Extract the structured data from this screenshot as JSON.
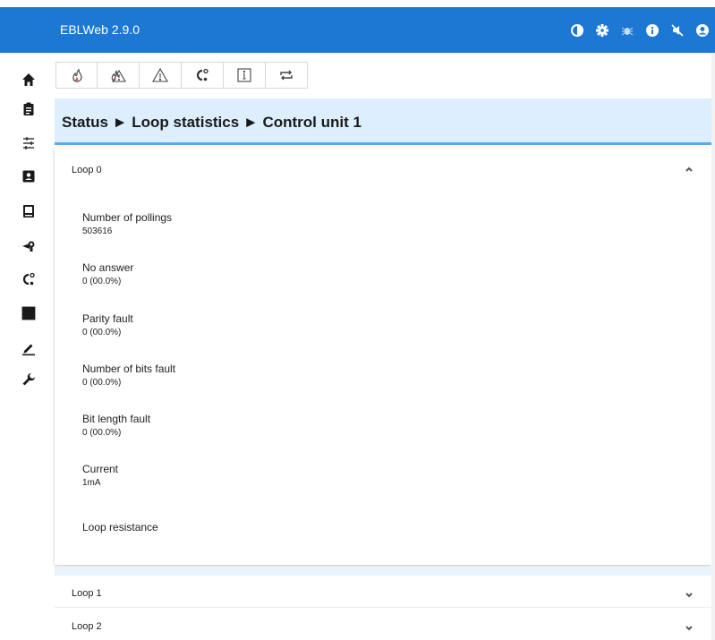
{
  "app": {
    "title": "EBLWeb 2.9.0"
  },
  "header_icons": [
    "contrast-icon",
    "settings-icon",
    "bug-icon",
    "info-icon",
    "mute-icon",
    "account-icon"
  ],
  "sidebar_icons": [
    "home-icon",
    "clipboard-icon",
    "sliders-icon",
    "contact-card-icon",
    "device-icon",
    "detector-icon",
    "loop-icon",
    "io-module-icon",
    "edit-icon",
    "wrench-icon"
  ],
  "toolbar_icons": [
    "fire-icon",
    "fire-warning-icon",
    "warning-icon",
    "loop-device-icon",
    "info-box-icon",
    "repeat-icon"
  ],
  "breadcrumb": "Status ► Loop statistics ► Control unit 1",
  "loop0": {
    "title": "Loop 0",
    "stats": [
      {
        "label": "Number of pollings",
        "value": "503616"
      },
      {
        "label": "No answer",
        "value": "0 (00.0%)"
      },
      {
        "label": "Parity fault",
        "value": "0 (00.0%)"
      },
      {
        "label": "Number of bits fault",
        "value": "0 (00.0%)"
      },
      {
        "label": "Bit length fault",
        "value": "0 (00.0%)"
      },
      {
        "label": "Current",
        "value": "1mA"
      },
      {
        "label": "Loop resistance",
        "value": ""
      }
    ]
  },
  "loop1": {
    "title": "Loop 1"
  },
  "loop2": {
    "title": "Loop 2"
  },
  "colors": {
    "header": "#1d78d4",
    "banner": "#ddefff",
    "banner_border": "#5aa9ec",
    "fire_red": "#d9534f"
  }
}
